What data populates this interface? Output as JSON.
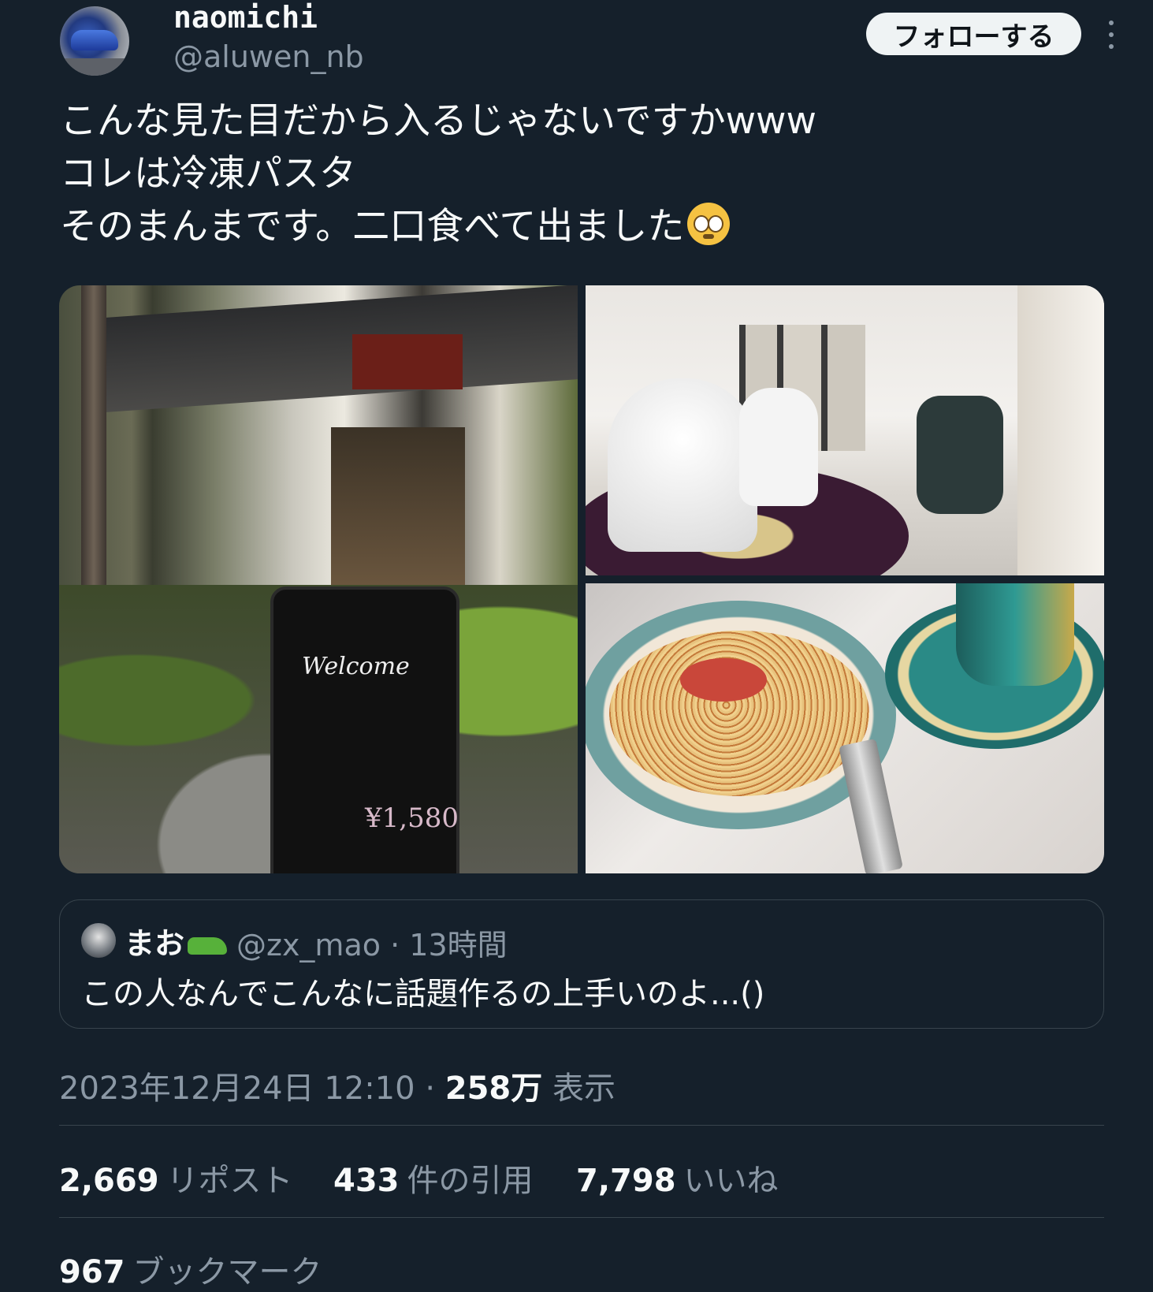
{
  "author": {
    "display_name": "naomichi",
    "handle": "@aluwen_nb",
    "avatar_icon": "car-avatar"
  },
  "follow_button_label": "フォローする",
  "more_icon": "more-options-icon",
  "tweet": {
    "lines": [
      "こんな見た目だから入るじゃないですかwww",
      "コレは冷凍パスタ",
      "そのまんまです。二口食べて出ました"
    ],
    "emoji_icon": "pleading-face-emoji"
  },
  "media": {
    "board_title": "Welcome",
    "board_price": "¥1,580"
  },
  "quoted": {
    "name": "まお",
    "name_emoji": "crocodile-emoji",
    "handle": "@zx_mao",
    "separator": "·",
    "time": "13時間",
    "text": "この人なんでこんなに話題作るの上手いのよ...()"
  },
  "meta": {
    "datetime": "2023年12月24日 12:10",
    "separator": "·",
    "views_count": "258万",
    "views_label": "表示"
  },
  "stats": {
    "reposts_count": "2,669",
    "reposts_label": "リポスト",
    "quotes_count": "433",
    "quotes_label": "件の引用",
    "likes_count": "7,798",
    "likes_label": "いいね",
    "bookmarks_count": "967",
    "bookmarks_label": "ブックマーク"
  }
}
